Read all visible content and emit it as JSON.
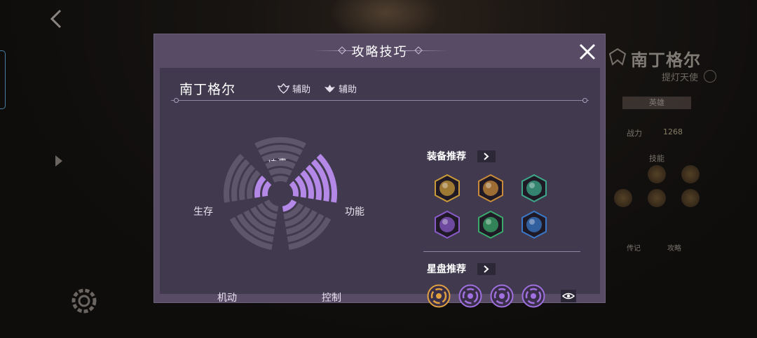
{
  "dialog": {
    "title": "攻略技巧",
    "hero_name": "南丁格尔",
    "roles": [
      {
        "label": "辅助",
        "icon": "role-support-icon"
      },
      {
        "label": "辅助",
        "icon": "role-support-alt-icon"
      }
    ]
  },
  "radar": {
    "axes": [
      "伤害",
      "功能",
      "控制",
      "机动",
      "生存"
    ],
    "levels_max": 6,
    "values": [
      0,
      6,
      1,
      0,
      2
    ],
    "fill_color": "#b488e6",
    "empty_color": "#5e566b"
  },
  "equipment": {
    "title": "装备推荐",
    "items": [
      {
        "icon": "golden-relic-icon",
        "ring": "#c99a3a"
      },
      {
        "icon": "winged-disc-icon",
        "ring": "#c98a3a"
      },
      {
        "icon": "jade-shield-icon",
        "ring": "#3ea88a"
      },
      {
        "icon": "violet-crystal-icon",
        "ring": "#8a5ac8"
      },
      {
        "icon": "emerald-horn-icon",
        "ring": "#3aa86a"
      },
      {
        "icon": "azure-blade-icon",
        "ring": "#3a78c8"
      }
    ]
  },
  "astrolabe": {
    "title": "星盘推荐",
    "runes": [
      {
        "icon": "golden-snowflake-rune-icon",
        "color": "#e0a040"
      },
      {
        "icon": "violet-vortex-rune-icon",
        "color": "#a070e0"
      },
      {
        "icon": "violet-flame-rune-icon",
        "color": "#a070e0"
      },
      {
        "icon": "violet-dragon-rune-icon",
        "color": "#a070e0"
      }
    ]
  },
  "background": {
    "hero_name": "南丁格尔",
    "hero_subtitle": "提灯天使",
    "tab": "英雄",
    "stat_label": "战力",
    "stat_value": "1268",
    "skills_label": "技能",
    "buttons": [
      "传记",
      "攻略"
    ]
  }
}
